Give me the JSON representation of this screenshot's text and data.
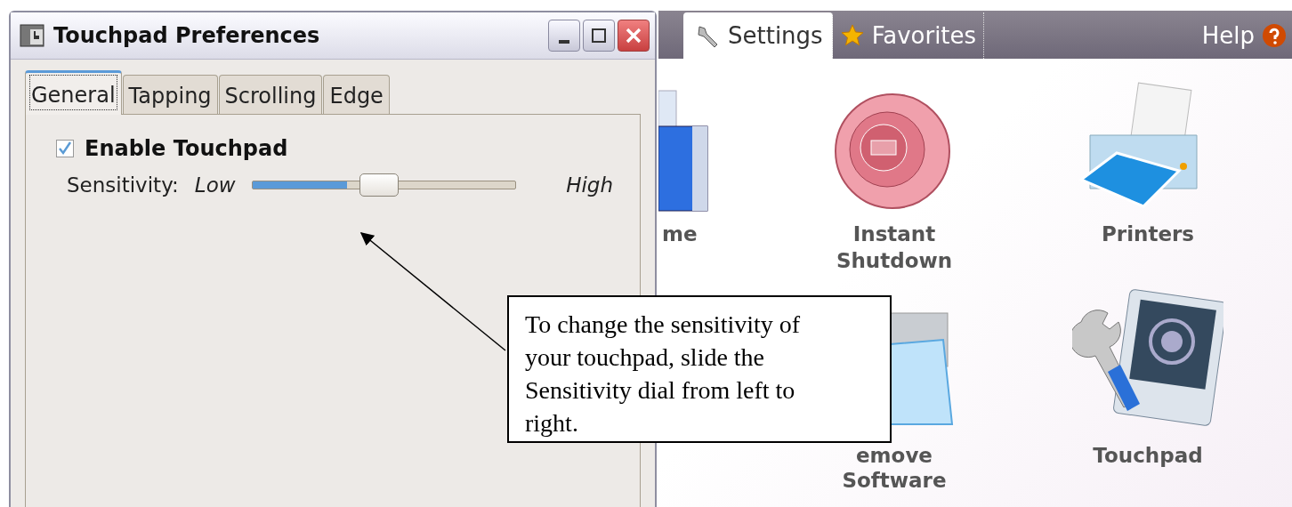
{
  "window": {
    "title": "Touchpad Preferences"
  },
  "tabs": [
    {
      "label": "General",
      "selected": true
    },
    {
      "label": "Tapping",
      "selected": false
    },
    {
      "label": "Scrolling",
      "selected": false
    },
    {
      "label": "Edge",
      "selected": false
    }
  ],
  "general": {
    "enable_checkbox": {
      "label": "Enable Touchpad",
      "checked": true
    },
    "sensitivity": {
      "label": "Sensitivity:",
      "low_label": "Low",
      "high_label": "High",
      "level": 0.36
    }
  },
  "control_center": {
    "tabs": [
      {
        "label": "Settings",
        "kind": "wrench",
        "selected": true
      },
      {
        "label": "Favorites",
        "kind": "star",
        "selected": false
      }
    ],
    "help": "Help",
    "items": [
      {
        "label": "me",
        "kind": "computer"
      },
      {
        "label": "Instant Shutdown",
        "kind": "shutdown"
      },
      {
        "label": "Printers",
        "kind": "printer"
      },
      {
        "kind": "blank"
      },
      {
        "label": "emove Software",
        "kind": "software"
      },
      {
        "label": "Touchpad",
        "kind": "touchpad"
      }
    ]
  },
  "callout": {
    "text": "To change the sensitivity of your touchpad, slide the Sensitivity dial from left to right."
  }
}
